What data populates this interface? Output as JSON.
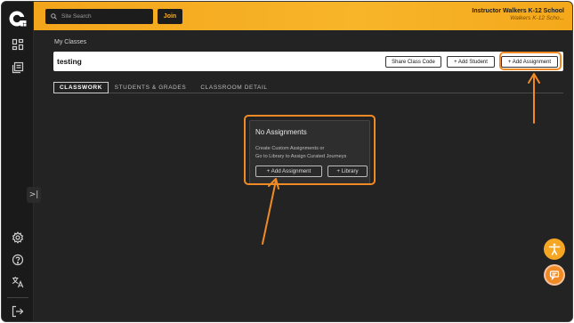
{
  "header": {
    "search_placeholder": "Site Search",
    "join_label": "Join",
    "user_name": "Instructor Walkers K-12 School",
    "user_sub": "Walkers K-12 Scho..."
  },
  "breadcrumb": "My Classes",
  "class_bar": {
    "title": "testing",
    "share_label": "Share Class Code",
    "add_student_label": "+ Add Student",
    "add_assignment_label": "+ Add Assignment"
  },
  "tabs": [
    {
      "label": "CLASSWORK",
      "active": true
    },
    {
      "label": "STUDENTS & GRADES",
      "active": false
    },
    {
      "label": "CLASSROOM DETAIL",
      "active": false
    }
  ],
  "empty_state": {
    "title": "No Assignments",
    "line1": "Create Custom Assignments or",
    "line2": "Go to Library to Assign Curated Journeys",
    "add_assignment_label": "+ Add Assignment",
    "library_label": "+ Library"
  },
  "sidebar": {
    "items": [
      "dashboard-icon",
      "library-icon",
      "gear-icon",
      "help-icon",
      "translate-icon",
      "logout-icon"
    ],
    "collapse_glyph": ">|"
  },
  "colors": {
    "accent": "#f5a623",
    "highlight": "#f08a24",
    "dark_bg": "#232323"
  }
}
